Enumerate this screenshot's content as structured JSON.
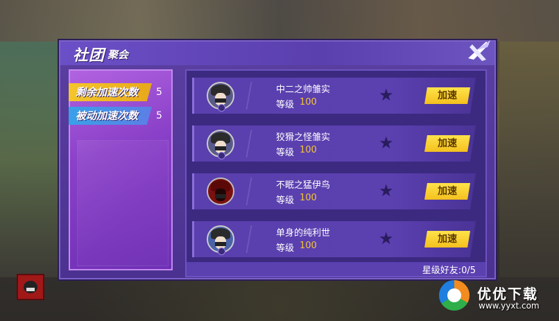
{
  "title": {
    "main": "社团",
    "sub": "聚会"
  },
  "counters": {
    "remaining": {
      "label": "剩余加速次数",
      "value": "5"
    },
    "passive": {
      "label": "被动加速次数",
      "value": "5"
    }
  },
  "friends": [
    {
      "name": "中二之帅雏实",
      "level_label": "等级",
      "level": "100",
      "button": "加速",
      "avatar": "avatar-dark-hair"
    },
    {
      "name": "狡猾之怪雏实",
      "level_label": "等级",
      "level": "100",
      "button": "加速",
      "avatar": "avatar-dark-hair"
    },
    {
      "name": "不眠之猛伊鸟",
      "level_label": "等级",
      "level": "100",
      "button": "加速",
      "avatar": "avatar-red"
    },
    {
      "name": "单身的纯利世",
      "level_label": "等级",
      "level": "100",
      "button": "加速",
      "avatar": "avatar-dark-hair"
    }
  ],
  "footer": {
    "star_friends": "星级好友:0/5"
  },
  "watermark": {
    "text": "优优下载",
    "url": "www.yyxt.com"
  },
  "colors": {
    "panel": "#5b3fa2",
    "button": "#f4c01e",
    "level": "#f5c530"
  },
  "icons": {
    "close": "close-x-icon",
    "star": "star-icon"
  }
}
